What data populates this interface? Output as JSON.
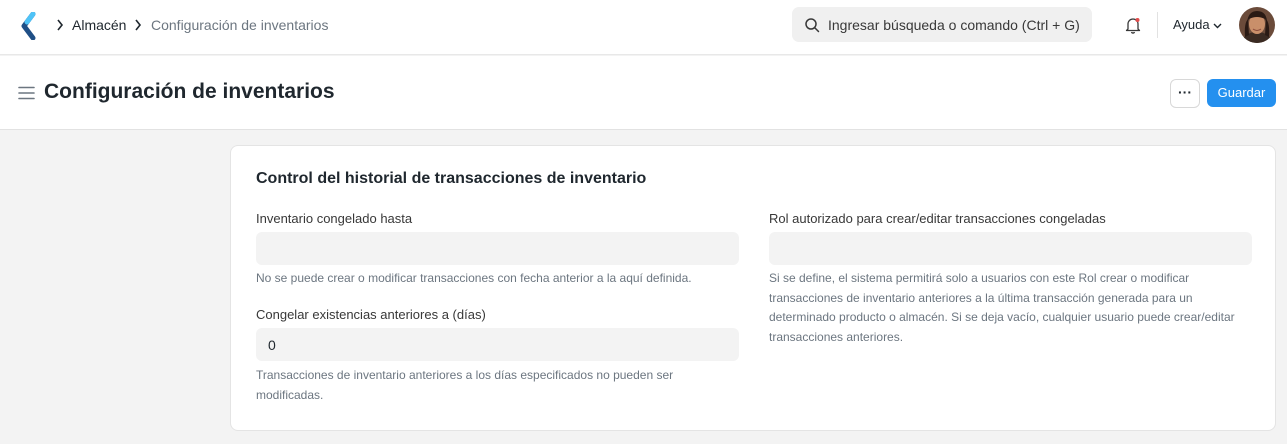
{
  "breadcrumb": {
    "items": [
      "Almacén",
      "Configuración de inventarios"
    ]
  },
  "search": {
    "placeholder": "Ingresar búsqueda o comando (Ctrl + G)"
  },
  "navbar": {
    "help_label": "Ayuda"
  },
  "page": {
    "title": "Configuración de inventarios",
    "more_label": "···",
    "save_label": "Guardar"
  },
  "section": {
    "title": "Control del historial de transacciones de inventario",
    "fields": [
      {
        "label": "Inventario congelado hasta",
        "value": "",
        "description": "No se puede crear o modificar transacciones con fecha anterior a la aquí definida."
      },
      {
        "label": "Congelar existencias anteriores a (días)",
        "value": "0",
        "description": "Transacciones de inventario anteriores a los días especificados no pueden ser modificadas."
      },
      {
        "label": "Rol autorizado para crear/editar transacciones congeladas",
        "value": "",
        "description": "Si se define, el sistema permitirá solo a usuarios con este Rol crear o modificar transacciones de inventario anteriores a la última transacción generada para un determinado producto o almacén. Si se deja vacío, cualquier usuario puede crear/editar transacciones anteriores."
      }
    ]
  },
  "colors": {
    "primary": "#2490ef",
    "text": "#1f272e",
    "muted": "#6c7680"
  },
  "icons": [
    "app-logo-icon",
    "chevron-right-icon",
    "search-icon",
    "bell-icon",
    "chevron-down-icon",
    "hamburger-icon"
  ]
}
